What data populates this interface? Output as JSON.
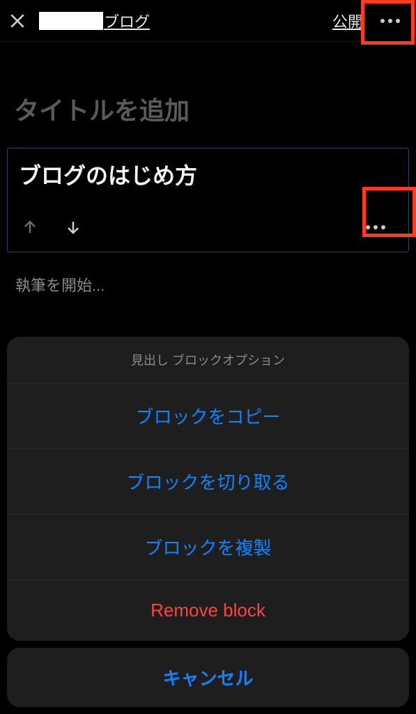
{
  "header": {
    "breadcrumb_suffix": "ブログ",
    "publish_label": "公開"
  },
  "editor": {
    "title_placeholder": "タイトルを追加",
    "selected_block_text": "ブログのはじめ方",
    "start_writing_placeholder": "執筆を開始..."
  },
  "action_sheet": {
    "title": "見出し ブロックオプション",
    "options": {
      "copy": "ブロックをコピー",
      "cut": "ブロックを切り取る",
      "duplicate": "ブロックを複製",
      "remove": "Remove block"
    },
    "cancel": "キャンセル"
  }
}
